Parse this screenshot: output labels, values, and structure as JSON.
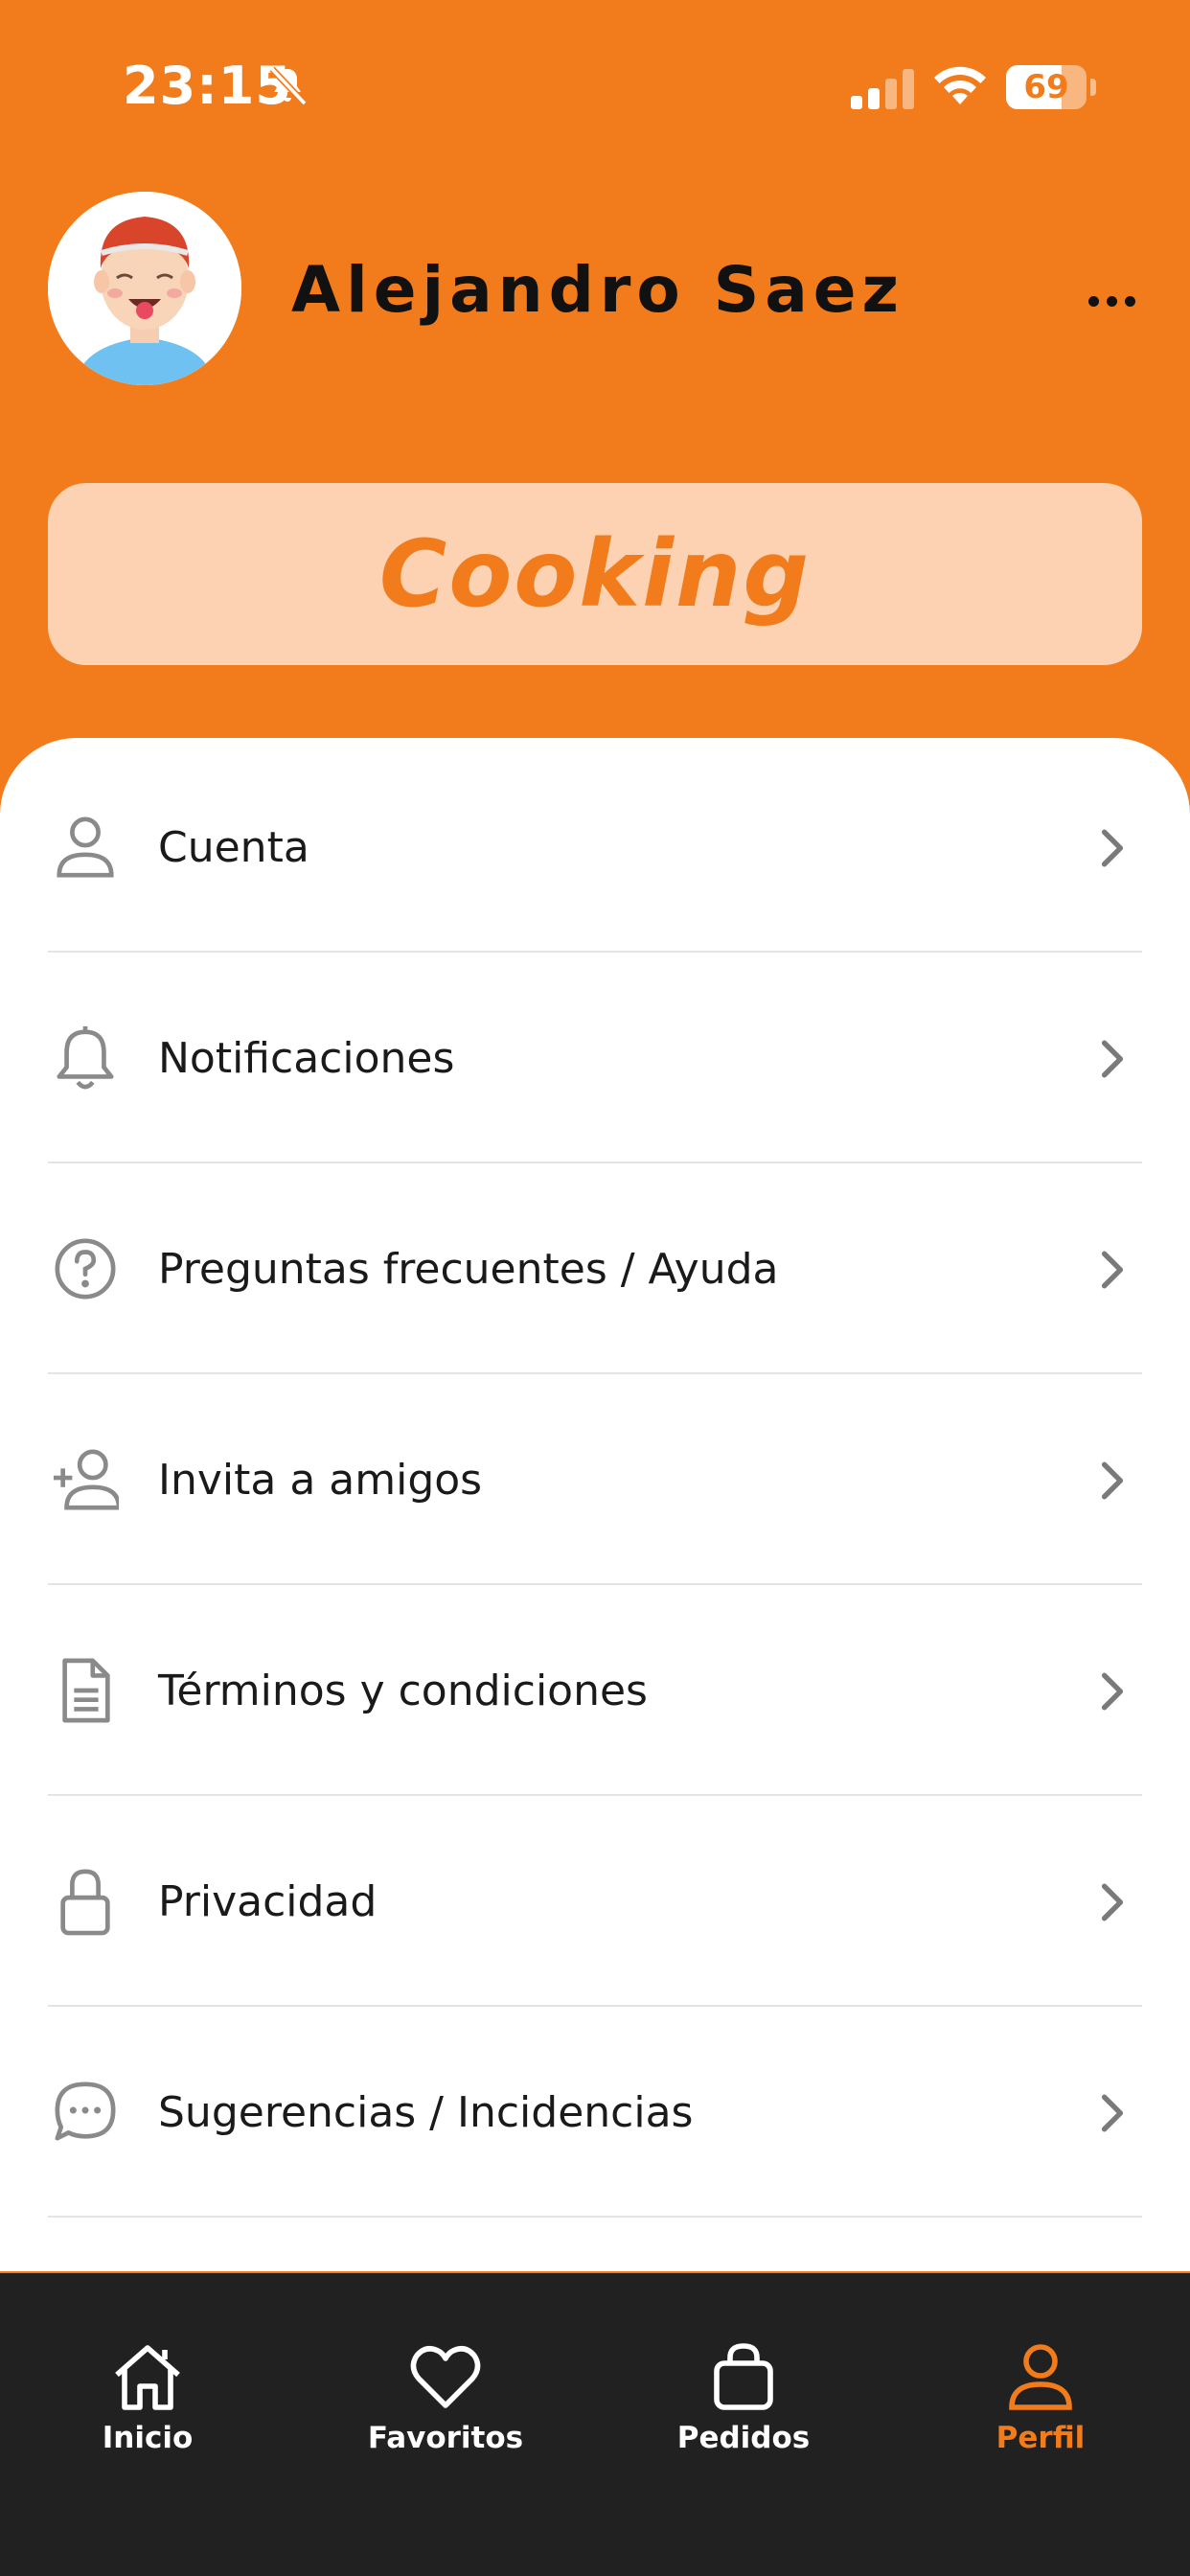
{
  "status_bar": {
    "time": "23:15",
    "battery": "69",
    "battery_level": 0.69,
    "icons": [
      "bell-slash-icon",
      "signal-icon",
      "wifi-icon",
      "battery-icon"
    ]
  },
  "profile": {
    "name": "Alejandro Saez",
    "avatar_icon": "avatar-illustration",
    "more_icon": "ellipsis-icon"
  },
  "brand": {
    "logo_text": "Cooking"
  },
  "menu": {
    "items": [
      {
        "label": "Cuenta",
        "icon": "user-icon"
      },
      {
        "label": "Notificaciones",
        "icon": "bell-icon"
      },
      {
        "label": "Preguntas frecuentes / Ayuda",
        "icon": "question-circle-icon"
      },
      {
        "label": "Invita a amigos",
        "icon": "user-plus-icon"
      },
      {
        "label": "Términos y condiciones",
        "icon": "document-icon"
      },
      {
        "label": "Privacidad",
        "icon": "lock-icon"
      },
      {
        "label": "Sugerencias / Incidencias",
        "icon": "chat-bubble-icon"
      }
    ]
  },
  "tab_bar": {
    "tabs": [
      {
        "label": "Inicio",
        "icon": "home-icon"
      },
      {
        "label": "Favoritos",
        "icon": "heart-icon"
      },
      {
        "label": "Pedidos",
        "icon": "shopping-bag-icon"
      },
      {
        "label": "Perfil",
        "icon": "user-icon"
      }
    ],
    "active": "Perfil"
  },
  "colors": {
    "primary": "#F27C1B",
    "banner": "#FDD2B3",
    "tab_bar_bg": "#212121",
    "sheet_bg": "#FFFFFF",
    "divider": "#E4E4E4",
    "icon_gray": "#8A8A8A"
  }
}
